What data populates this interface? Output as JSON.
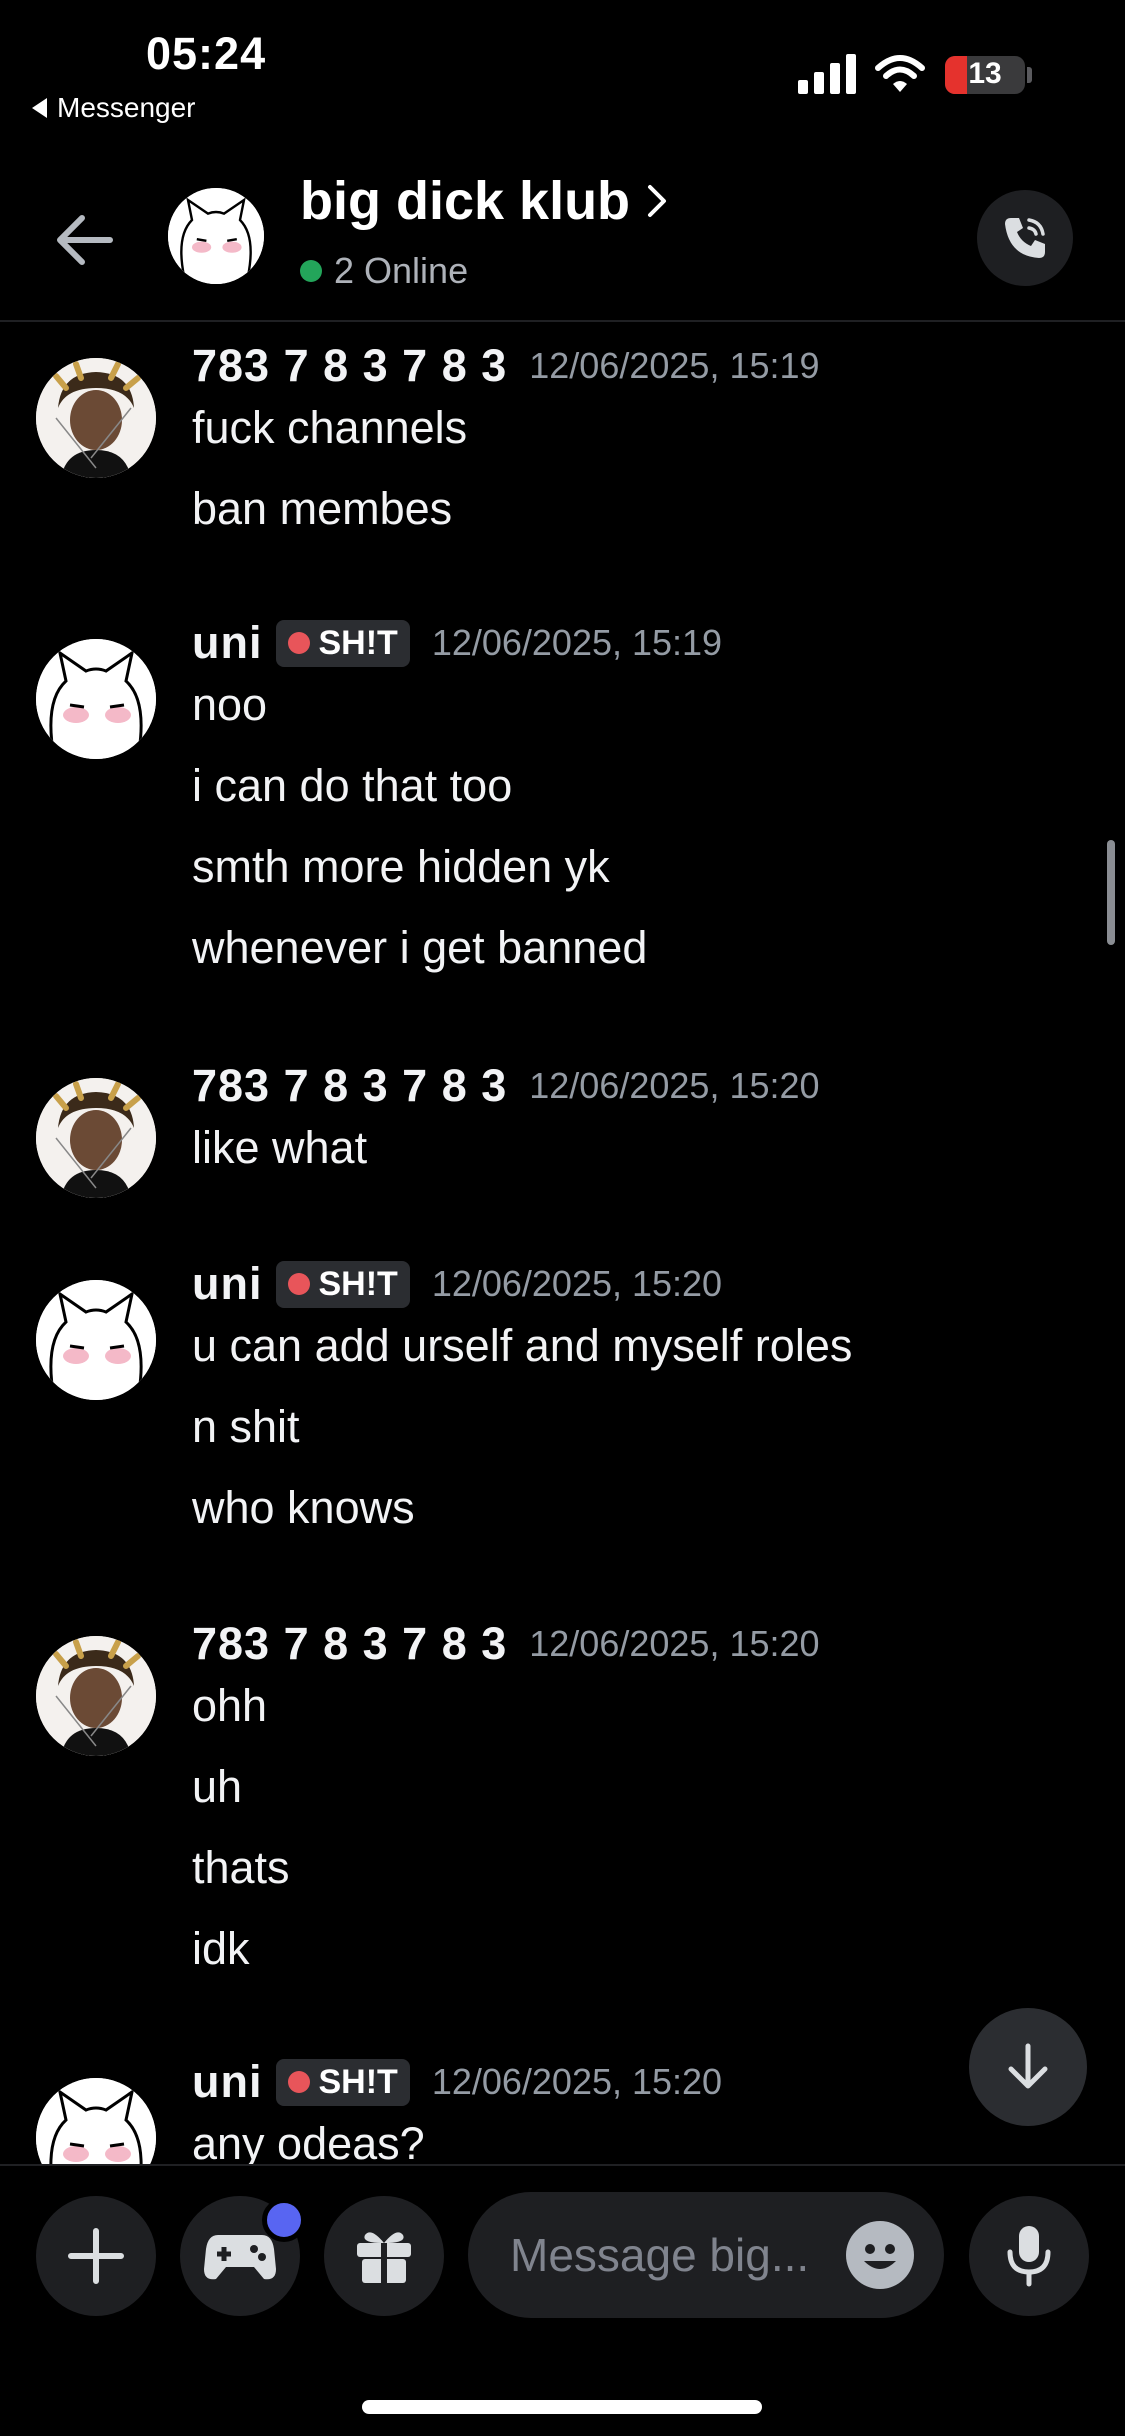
{
  "status_bar": {
    "time": "05:24",
    "back_app": "Messenger",
    "battery": "13",
    "battery_level": 0.13,
    "battery_color": "#e5322d"
  },
  "header": {
    "title": "big dick klub",
    "online": "2 Online",
    "online_color": "#23a55a"
  },
  "messages": [
    {
      "author": "783 7 8 3 7  8  3",
      "avatar": "photo-avatar",
      "tag": null,
      "time": "12/06/2025, 15:19",
      "lines": [
        "fuck channels",
        "ban membes"
      ]
    },
    {
      "author": "uni",
      "avatar": "cat-avatar",
      "tag": "SH!T",
      "time": "12/06/2025, 15:19",
      "lines": [
        "noo",
        "i can do that too",
        "smth more hidden yk",
        "whenever i get banned"
      ]
    },
    {
      "author": "783 7 8 3 7  8  3",
      "avatar": "photo-avatar",
      "tag": null,
      "time": "12/06/2025, 15:20",
      "lines": [
        "like what"
      ]
    },
    {
      "author": "uni",
      "avatar": "cat-avatar",
      "tag": "SH!T",
      "time": "12/06/2025, 15:20",
      "lines": [
        "u can add urself and myself roles",
        "n shit",
        "who knows"
      ]
    },
    {
      "author": "783 7 8 3 7  8  3",
      "avatar": "photo-avatar",
      "tag": null,
      "time": "12/06/2025, 15:20",
      "lines": [
        "ohh",
        "uh",
        "thats",
        "idk"
      ]
    },
    {
      "author": "uni",
      "avatar": "cat-avatar",
      "tag": "SH!T",
      "time": "12/06/2025, 15:20",
      "lines": [
        "any odeas?"
      ]
    }
  ],
  "composer": {
    "placeholder": "Message big...",
    "icons": [
      "plus-icon",
      "gamepad-icon",
      "gift-icon",
      "emoji-icon",
      "microphone-icon"
    ],
    "accent": "#5865f2"
  }
}
